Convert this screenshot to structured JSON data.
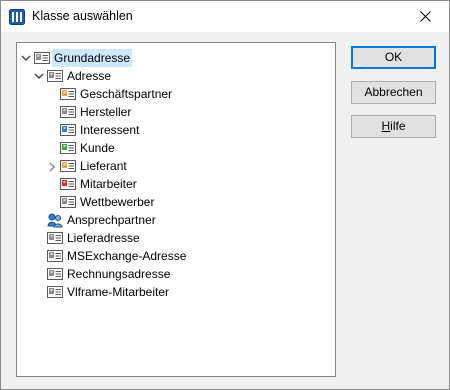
{
  "window": {
    "title": "Klasse auswählen"
  },
  "tree": {
    "nodes": [
      {
        "label": "Grundadresse",
        "level": 0,
        "toggle": "expanded",
        "icon": "card-gray",
        "selected": true
      },
      {
        "label": "Adresse",
        "level": 1,
        "toggle": "expanded",
        "icon": "card-gray"
      },
      {
        "label": "Geschäftspartner",
        "level": 2,
        "toggle": "none",
        "icon": "card-orange"
      },
      {
        "label": "Hersteller",
        "level": 2,
        "toggle": "none",
        "icon": "card-gray"
      },
      {
        "label": "Interessent",
        "level": 2,
        "toggle": "none",
        "icon": "card-blue"
      },
      {
        "label": "Kunde",
        "level": 2,
        "toggle": "none",
        "icon": "card-green"
      },
      {
        "label": "Lieferant",
        "level": 2,
        "toggle": "collapsed",
        "icon": "card-orange"
      },
      {
        "label": "Mitarbeiter",
        "level": 2,
        "toggle": "none",
        "icon": "card-red"
      },
      {
        "label": "Wettbewerber",
        "level": 2,
        "toggle": "none",
        "icon": "card-gray"
      },
      {
        "label": "Ansprechpartner",
        "level": 1,
        "toggle": "none",
        "icon": "contact-people"
      },
      {
        "label": "Lieferadresse",
        "level": 1,
        "toggle": "none",
        "icon": "card-gray"
      },
      {
        "label": "MSExchange-Adresse",
        "level": 1,
        "toggle": "none",
        "icon": "card-gray"
      },
      {
        "label": "Rechnungsadresse",
        "level": 1,
        "toggle": "none",
        "icon": "card-gray"
      },
      {
        "label": "Vlframe-Mitarbeiter",
        "level": 1,
        "toggle": "none",
        "icon": "card-gray"
      }
    ]
  },
  "buttons": {
    "ok": "OK",
    "cancel": "Abbrechen",
    "help_first": "H",
    "help_rest": "ilfe"
  },
  "colors": {
    "selection": "#cce8ff",
    "default_button_border": "#0078d7",
    "card_gray": "#8c8c8c",
    "card_orange": "#e8a33a",
    "card_blue": "#2f7ed8",
    "card_green": "#3faa3f",
    "card_red": "#d83030"
  }
}
